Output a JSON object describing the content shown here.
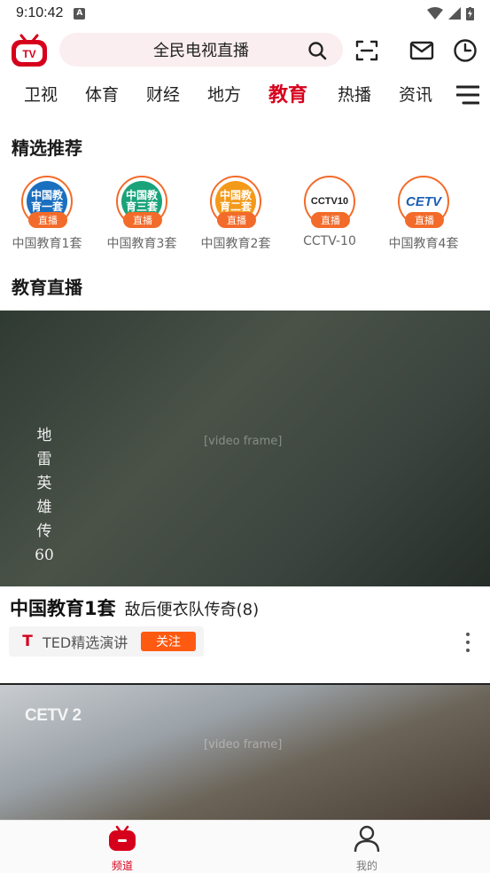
{
  "status_bar": {
    "time": "9:10:42",
    "notification_letter": "A"
  },
  "header": {
    "search_text": "全民电视直播"
  },
  "tabs": [
    {
      "label": "卫视",
      "active": false
    },
    {
      "label": "体育",
      "active": false
    },
    {
      "label": "财经",
      "active": false
    },
    {
      "label": "地方",
      "active": false
    },
    {
      "label": "教育",
      "active": true
    },
    {
      "label": "热播",
      "active": false
    },
    {
      "label": "资讯",
      "active": false
    }
  ],
  "featured": {
    "title": "精选推荐",
    "channels": [
      {
        "name": "中国教育1套",
        "logo_text": "中国教育一套",
        "badge": "直播",
        "color": "#1b6fbf"
      },
      {
        "name": "中国教育3套",
        "logo_text": "中国教育三套",
        "badge": "直播",
        "color": "#1aa37a"
      },
      {
        "name": "中国教育2套",
        "logo_text": "中国教育二套",
        "badge": "直播",
        "color": "#f39a1a"
      },
      {
        "name": "CCTV-10",
        "logo_text": "CCTV10",
        "badge": "直播",
        "color": "#ffffff"
      },
      {
        "name": "中国教育4套",
        "logo_text": "CETV",
        "badge": "直播",
        "color": "#ffffff"
      }
    ]
  },
  "live": {
    "title": "教育直播",
    "video_label": "地雷英雄传60",
    "channel": "中国教育1套",
    "show": "敌后便衣队传奇(8)",
    "tag_logo": "T",
    "tag_text": "TED精选演讲",
    "follow_label": "关注",
    "second_watermark": "CETV 2"
  },
  "bottom_nav": [
    {
      "label": "频道",
      "active": true
    },
    {
      "label": "我的",
      "active": false
    }
  ],
  "colors": {
    "accent": "#d6001c",
    "orange": "#f36b2a",
    "follow": "#ff5a12"
  }
}
